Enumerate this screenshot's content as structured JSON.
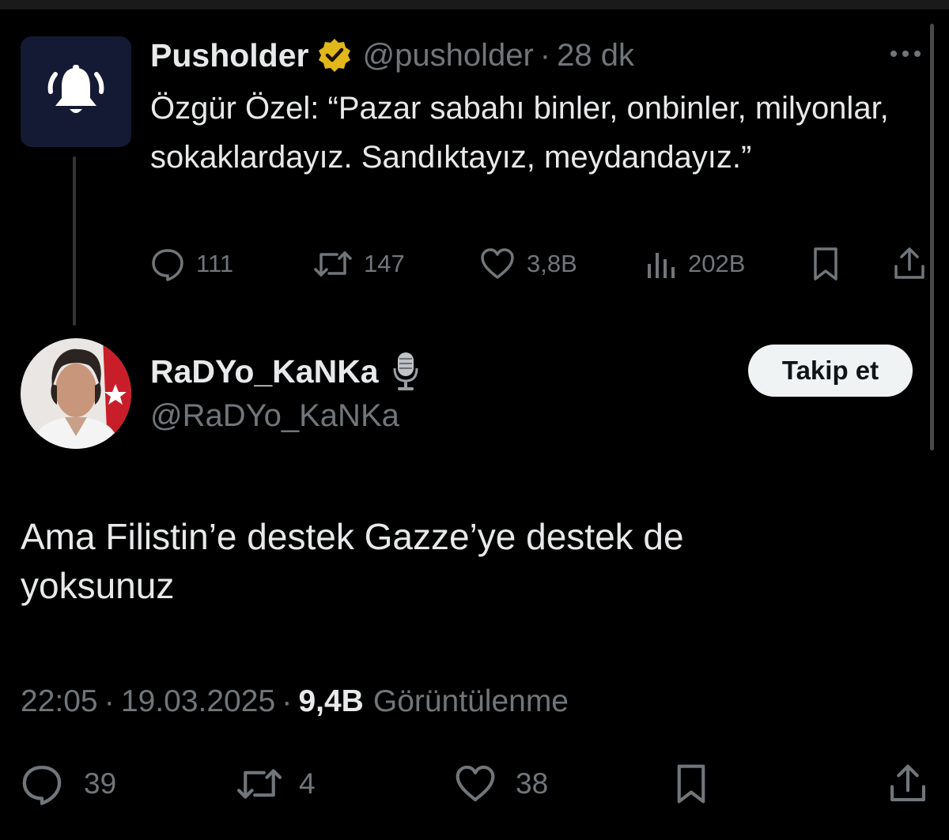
{
  "parent_tweet": {
    "author_name": "Pusholder",
    "handle": "@pusholder",
    "separator": "·",
    "time": "28 dk",
    "text": "Özgür Özel: “Pazar sabahı binler, onbinler, milyonlar, sokaklardayız. Sandıktayız, meydandayız.”",
    "replies": "111",
    "reposts": "147",
    "likes": "3,8B",
    "views": "202B",
    "avatar_icon": "bell-icon",
    "verified_color": "#e2b719"
  },
  "reply_tweet": {
    "author_name": "RaDYo_KaNKa",
    "handle": "@RaDYo_KaNKa",
    "follow_label": "Takip et",
    "text": "Ama Filistin’e destek Gazze’ye destek de yoksunuz",
    "time": "22:05",
    "separator": "·",
    "date": "19.03.2025",
    "views_count": "9,4B",
    "views_label": "Görüntülenme",
    "replies": "39",
    "reposts": "4",
    "likes": "38"
  },
  "colors": {
    "background": "#000000",
    "text_primary": "#e7e9ea",
    "text_secondary": "#71767b",
    "button_bg": "#eff3f4"
  }
}
